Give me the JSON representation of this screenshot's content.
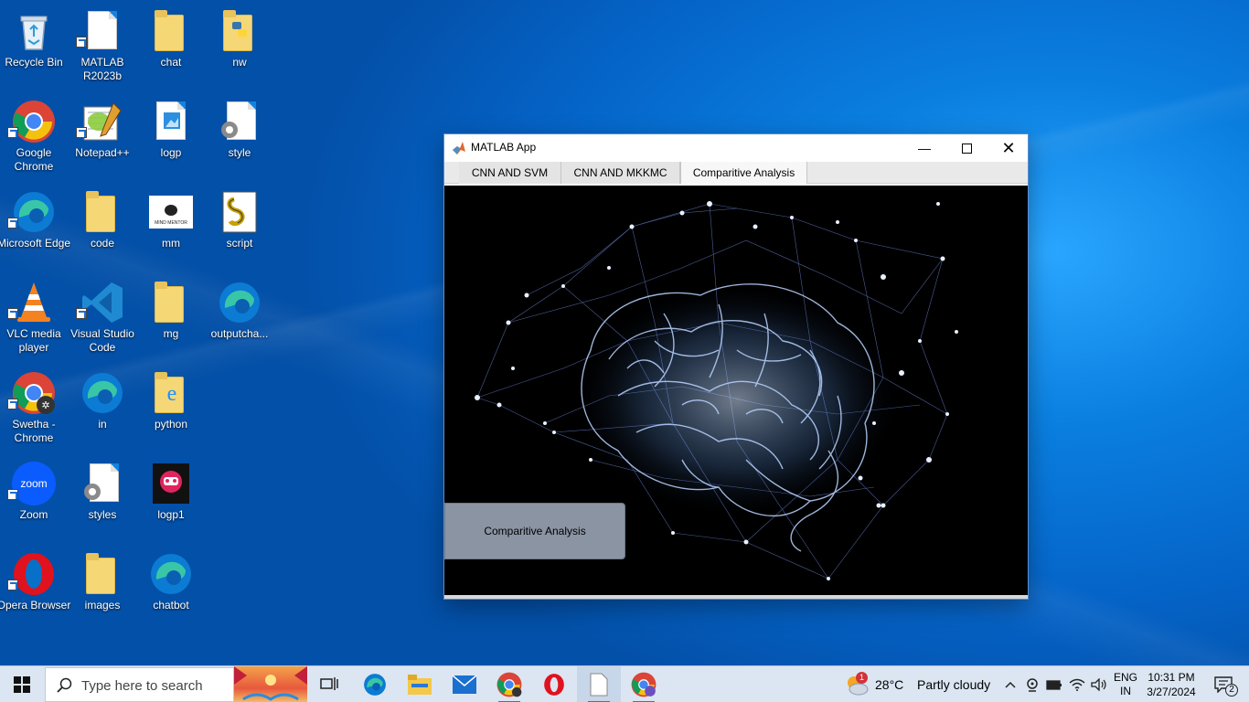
{
  "desktop": {
    "icons": [
      {
        "label": "Recycle Bin"
      },
      {
        "label": "MATLAB R2023b"
      },
      {
        "label": "chat"
      },
      {
        "label": "nw"
      },
      {
        "label": "Google Chrome"
      },
      {
        "label": "Notepad++"
      },
      {
        "label": "logp"
      },
      {
        "label": "style"
      },
      {
        "label": "Microsoft Edge"
      },
      {
        "label": "code"
      },
      {
        "label": "mm"
      },
      {
        "label": "script"
      },
      {
        "label": "VLC media player"
      },
      {
        "label": "Visual Studio Code"
      },
      {
        "label": "mg"
      },
      {
        "label": "outputcha..."
      },
      {
        "label": "Swetha - Chrome"
      },
      {
        "label": "in"
      },
      {
        "label": "python"
      },
      {
        "label": "Zoom"
      },
      {
        "label": "styles"
      },
      {
        "label": "logp1"
      },
      {
        "label": "Opera Browser"
      },
      {
        "label": "images"
      },
      {
        "label": "chatbot"
      }
    ],
    "mm_logo_text": "MIND MENTOR",
    "zoom_logo_text": "zoom"
  },
  "window": {
    "title": "MATLAB App",
    "tabs": [
      {
        "label": "CNN AND SVM"
      },
      {
        "label": "CNN AND MKKMC"
      },
      {
        "label": "Comparitive Analysis",
        "active": true
      }
    ],
    "button_label": "Comparitive Analysis"
  },
  "taskbar": {
    "search_placeholder": "Type here to search",
    "weather": {
      "temp": "28°C",
      "condition": "Partly cloudy",
      "badge": "1"
    },
    "language": {
      "line1": "ENG",
      "line2": "IN"
    },
    "clock": {
      "time": "10:31 PM",
      "date": "3/27/2024"
    },
    "notifications": "2"
  },
  "colors": {
    "accent": "#0078d7",
    "button_bg": "#8b94a3",
    "taskbar_bg": "#dbe6f2"
  }
}
